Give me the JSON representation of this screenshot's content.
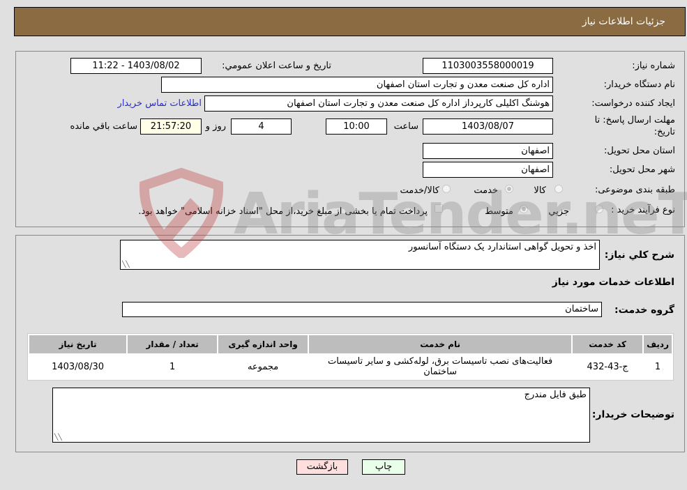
{
  "header": {
    "title": "جزئیات اطلاعات نیاز"
  },
  "form": {
    "need_number_label": "شماره نیاز:",
    "need_number": "1103003558000019",
    "announce_label": "تاریخ و ساعت اعلان عمومي:",
    "announce_value": "1403/08/02 - 11:22",
    "buyer_org_label": "نام دستگاه خریدار:",
    "buyer_org": "اداره کل صنعت  معدن و تجارت استان اصفهان",
    "creator_label": "ایجاد کننده درخواست:",
    "creator": "هوشنگ  اکلیلی کارپرداز اداره کل صنعت  معدن و تجارت استان اصفهان",
    "contact_link": "اطلاعات تماس خریدار",
    "deadline_label_line1": "مهلت ارسال پاسخ: تا",
    "deadline_label_line2": "تاریخ:",
    "deadline_date": "1403/08/07",
    "time_label": "ساعت",
    "deadline_time": "10:00",
    "days_value": "4",
    "days_label": "روز و",
    "remaining_time": "21:57:20",
    "remaining_label": "ساعت باقي مانده",
    "province_label": "استان محل تحویل:",
    "province": "اصفهان",
    "city_label": "شهر محل تحویل:",
    "city": "اصفهان",
    "category_label": "طبقه بندی موضوعی:",
    "category_options": [
      {
        "label": "کالا",
        "checked": false
      },
      {
        "label": "خدمت",
        "checked": true
      },
      {
        "label": "کالا/خدمت",
        "checked": false
      }
    ],
    "process_label": "نوع فرآیند خرید :",
    "process_options": [
      {
        "label": "جزيي",
        "checked": false
      },
      {
        "label": "متوسط",
        "checked": true
      }
    ],
    "treasury_note": "پرداخت تمام یا بخشی از مبلغ خرید،از محل \"اسناد خزانه اسلامی\" خواهد بود."
  },
  "details": {
    "summary_label": "شرح کلي نیاز:",
    "summary": "اخذ و تحویل گواهی استاندارد یک دستگاه آسانسور",
    "services_heading": "اطلاعات خدمات مورد نیاز",
    "service_group_label": "گروه خدمت:",
    "service_group": "ساختمان",
    "table": {
      "headers": [
        "ردیف",
        "کد خدمت",
        "نام خدمت",
        "واحد اندازه گیری",
        "تعداد / مقدار",
        "تاریخ نیاز"
      ],
      "rows": [
        [
          "1",
          "ج-43-432",
          "فعالیت‌های نصب تاسیسات برق، لوله‌کشی و سایر تاسیسات ساختمان",
          "مجموعه",
          "1",
          "1403/08/30"
        ]
      ]
    },
    "buyer_notes_label": "توضیحات خریدار:",
    "buyer_notes": "طبق فایل مندرج"
  },
  "buttons": {
    "print": "چاپ",
    "back": "بازگشت"
  },
  "watermark": {
    "text": "AriaTender.neT"
  },
  "colors": {
    "header_bg": "#8b6b42",
    "print_bg": "#eaffea",
    "back_bg": "#ffdede",
    "link": "#2a2ad0"
  }
}
